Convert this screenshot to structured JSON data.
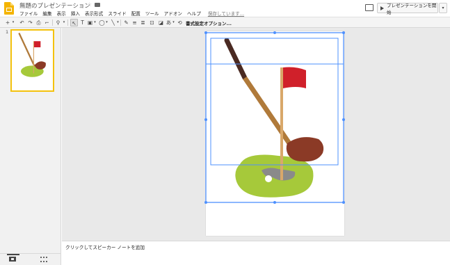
{
  "app": {
    "title": "無題のプレゼンテーション",
    "saving_status": "保存しています..."
  },
  "menu": [
    "ファイル",
    "編集",
    "表示",
    "挿入",
    "表示形式",
    "スライド",
    "配置",
    "ツール",
    "アドオン",
    "ヘルプ"
  ],
  "header": {
    "present_label": "プレゼンテーションを開始",
    "present_dropdown": "▾"
  },
  "toolbar": {
    "format_options": "書式設定オプション..."
  },
  "filmstrip": {
    "slide_number": "1"
  },
  "notes": {
    "placeholder": "クリックしてスピーカー ノートを追加"
  },
  "colors": {
    "logo_yellow": "#f4b400",
    "selection_blue": "#4d90fe",
    "flag_red": "#d0202a",
    "green": "#a6c93a",
    "club_brown": "#8b3a26",
    "shaft_tan": "#b07a3a",
    "grip_dark": "#4a2a22",
    "pole_tan": "#d9a86a",
    "hole_gray": "#8a8a8a"
  },
  "icons": [
    "docs-logo-icon",
    "star-icon",
    "folder-icon",
    "comment-icon",
    "play-icon"
  ]
}
